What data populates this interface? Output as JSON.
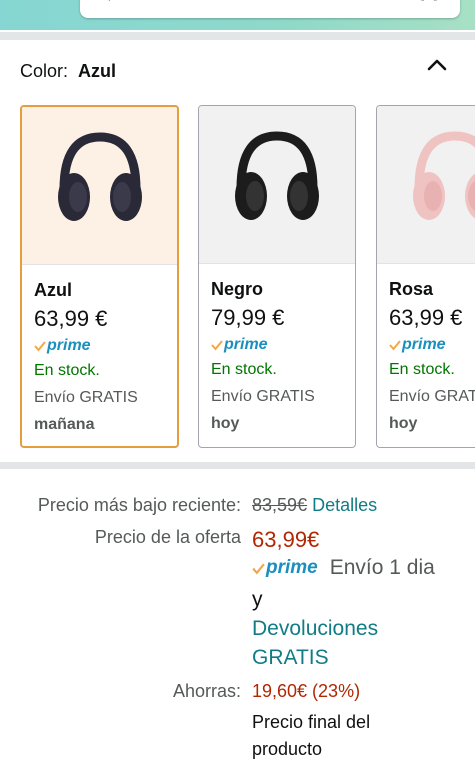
{
  "colors": {
    "accent_selected": "#e59d3d",
    "stock_green": "#007600",
    "price_red": "#b12704",
    "link_teal": "#117c85",
    "prime_blue": "#1b8fbd"
  },
  "color_selector": {
    "label": "Color:",
    "value": "Azul",
    "collapse_icon": "chevron-up-icon"
  },
  "variants": [
    {
      "name": "Azul",
      "price": "63,99 €",
      "prime": "prime",
      "stock": "En stock.",
      "shipping": "Envío GRATIS",
      "delivery": "mañana",
      "headphone_color": "#2a2937"
    },
    {
      "name": "Negro",
      "price": "79,99 €",
      "prime": "prime",
      "stock": "En stock.",
      "shipping": "Envío GRATIS",
      "delivery": "hoy",
      "headphone_color": "#1c1c1c"
    },
    {
      "name": "Rosa",
      "price": "63,99 €",
      "prime": "prime",
      "stock": "En stock.",
      "shipping": "Envío GRATIS",
      "delivery": "hoy",
      "headphone_color": "#f0c3c3"
    }
  ],
  "pricing": {
    "recent_low_label": "Precio más bajo reciente:",
    "recent_low_value": "83,59€",
    "details_link": "Detalles",
    "deal_label": "Precio de la oferta",
    "deal_value": "63,99€",
    "prime_word": "prime",
    "shipping_text_1": "Envío 1 dia",
    "shipping_text_2": "y",
    "returns_line_1": "Devoluciones",
    "returns_line_2": "GRATIS",
    "savings_label": "Ahorras:",
    "savings_value": "19,60€ (23%)",
    "final_line_1": "Precio final del",
    "final_line_2": "producto"
  }
}
